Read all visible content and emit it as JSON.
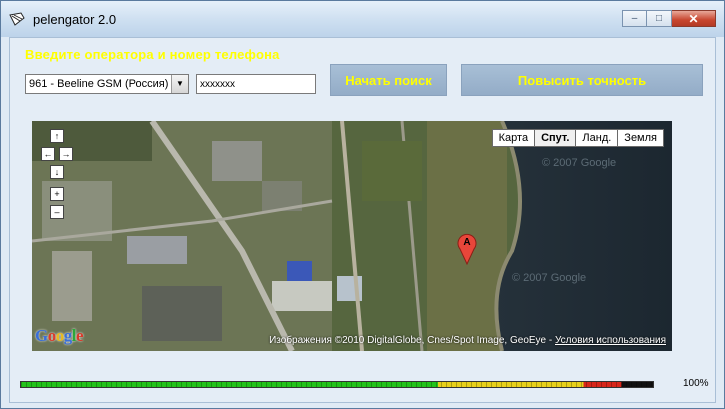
{
  "window": {
    "title": "pelengator 2.0",
    "minimize_glyph": "–",
    "maximize_glyph": "□",
    "close_glyph": "✕"
  },
  "form": {
    "prompt": "Введите оператора и номер телефона",
    "operator_selected": "961 - Beeline GSM (Россия)",
    "select_arrow": "▼",
    "phone_value": "xxxxxxx",
    "search_button": "Начать поиск",
    "accuracy_button": "Повысить точность"
  },
  "map": {
    "types": [
      "Карта",
      "Спут.",
      "Ланд.",
      "Земля"
    ],
    "active_type": "Спут.",
    "nav": {
      "up": "↑",
      "left": "←",
      "right": "→",
      "down": "↓",
      "zoom_in": "+",
      "zoom_out": "–"
    },
    "google_logo": "Google",
    "marker_label": "A",
    "attribution": "Изображения ©2010 DigitalGlobe, Cnes/Spot Image, GeoEye - ",
    "terms_link": "Условия использования",
    "watermarks": [
      "© 2007 Google",
      "© 2007 Google"
    ]
  },
  "progress": {
    "value": 1.0,
    "label": "100%"
  },
  "colors": {
    "prompt_text": "#ffff00",
    "button_text": "#ffff00",
    "button_bg": "#9ab3cd",
    "progress_green": "#22c41a",
    "progress_yellow": "#e8d11a",
    "progress_red": "#d9261a"
  },
  "icons": {
    "app": "pelengator-icon",
    "marker": "map-pin-icon"
  }
}
